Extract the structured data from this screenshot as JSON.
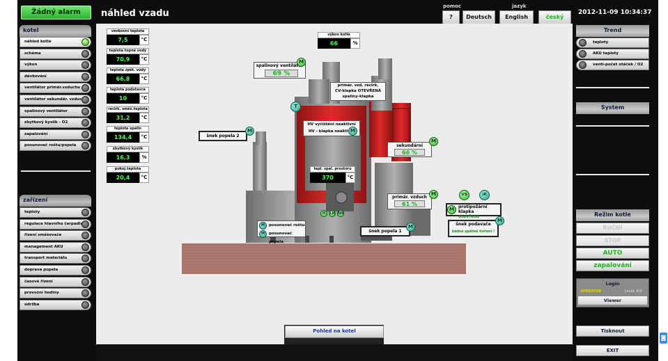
{
  "header": {
    "alarm": "Žádný alarm",
    "title": "náhled vzadu",
    "help_label": "pomoc",
    "help_button": "?",
    "lang_label": "jazyk",
    "languages": [
      "Deutsch",
      "English",
      "český"
    ],
    "datetime": "2012-11-09 10:34:37"
  },
  "left_menu": {
    "kotel": {
      "title": "kotel",
      "items": [
        {
          "label": "náhled kotle",
          "selected": true
        },
        {
          "label": "schéma"
        },
        {
          "label": "výkon"
        },
        {
          "label": "dávkování"
        },
        {
          "label": "ventilátor primár.vzduchu"
        },
        {
          "label": "ventilátor sekundár. vzduchu"
        },
        {
          "label": "spalinový ventilátor"
        },
        {
          "label": "zbytkový kyslík - O2"
        },
        {
          "label": "zapalování"
        },
        {
          "label": "posunovač roštu/popela"
        }
      ]
    },
    "zarizeni": {
      "title": "zařízení",
      "items": [
        {
          "label": "teploty"
        },
        {
          "label": "regulace hlavního čerpadla"
        },
        {
          "label": "řízení směšovače"
        },
        {
          "label": "management AKU"
        },
        {
          "label": "transport materiálu"
        },
        {
          "label": "doprava popela"
        },
        {
          "label": "časové řízení"
        },
        {
          "label": "provozní hodiny"
        },
        {
          "label": "údržba"
        }
      ]
    }
  },
  "right_menu": {
    "trend_title": "Trend",
    "trend_items": [
      "teploty",
      "AKU teploty",
      "venti-počet otáček / O2"
    ],
    "system_title": "System",
    "rezim_title": "Režim kotle",
    "rezim_buttons": [
      "RUČNÍ",
      "STOP",
      "AUTO",
      "zapalování"
    ],
    "login": "Login",
    "operator": "OPERATOR",
    "level": "Level: 4/3",
    "viewer": "Viewer",
    "print": "Tisknout",
    "exit": "EXIT"
  },
  "sensors": [
    {
      "label": "venkovní teplota",
      "value": "7,5",
      "unit": "°C"
    },
    {
      "label": "teplota topné vody",
      "value": "70,9",
      "unit": "°C"
    },
    {
      "label": "teplota zpět. vody",
      "value": "66,8",
      "unit": "°C"
    },
    {
      "label": "teplota podstavce",
      "value": "10",
      "unit": "°C"
    },
    {
      "label": "recirk. směš.teplota",
      "value": "31,2",
      "unit": "°C"
    },
    {
      "label": "teplota spalin",
      "value": "134,4",
      "unit": "°C"
    },
    {
      "label": "zbytkový kyslík",
      "value": "16,3",
      "unit": "%"
    },
    {
      "label": "pokoj.teplota",
      "value": "20,4",
      "unit": "°C"
    }
  ],
  "boiler": {
    "vykon_label": "výkon kotle",
    "vykon_value": "66",
    "vykon_unit": "%",
    "spalinovy_label": "spalinový ventilátor",
    "spalinovy_value": "69 %",
    "recirc_line1": "primár. vzd. recirk.",
    "recirc_line2": "CV-klapka OTEVŘENÁ",
    "recirc_line3": "spaliny-klapka",
    "hv_line1": "HV vyčištění neaktivní",
    "hv_line2": "HV - klapka neaktivní",
    "snek2": "šnek popela 2",
    "sekundarni_label": "sekundární vzduch",
    "sekundarni_value": "66 %",
    "tepl_label": "tepl. spal. prostoru",
    "tepl_value": "370",
    "tepl_unit": "°C",
    "primar_label": "primár. vzduch",
    "primar_value": "61 %",
    "protipozarni_line1": "protipožární klapka",
    "protipozarni_line2": "otevřeno",
    "snek1": "šnek popela 1",
    "snek_podavace": "šnek podavače",
    "zadne_hoeni": "žádné zpětné hoření !",
    "posun_rostu": "posunovač roštu",
    "posun_popela": "posunovač popela",
    "pohled_button": "Pohled na kotel",
    "m_letter": "M",
    "t_letter": "T",
    "vs_label": "VS",
    "ir_label": "IR",
    "small_codes": [
      "H",
      "LH",
      "NH"
    ]
  }
}
